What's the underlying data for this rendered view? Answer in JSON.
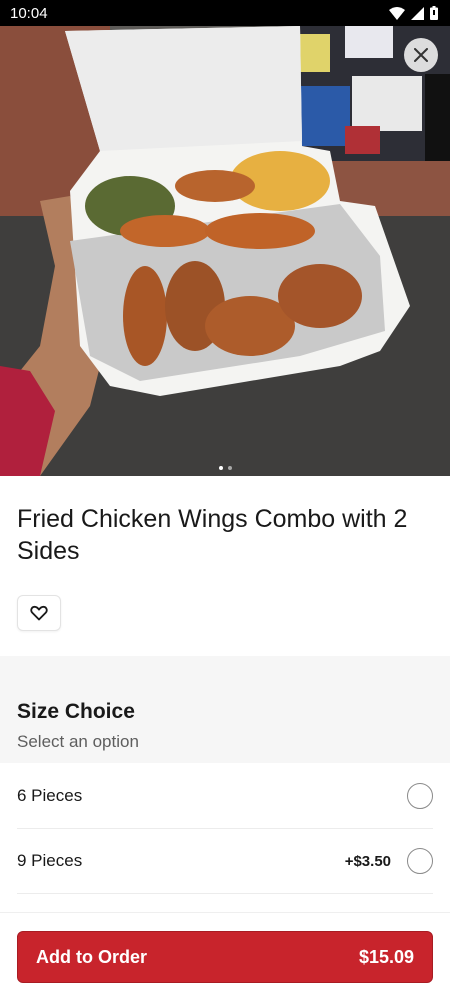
{
  "status_bar": {
    "time": "10:04",
    "icons": [
      "wifi-icon",
      "cell-signal-icon",
      "battery-icon"
    ]
  },
  "hero": {
    "image_description": "Hand holding a takeout container with fried chicken wings, green beans and mac and cheese",
    "slide_count": 2,
    "active_slide": 1
  },
  "item": {
    "title": "Fried Chicken Wings Combo with 2 Sides"
  },
  "size_choice": {
    "title": "Size Choice",
    "subtitle": "Select an option",
    "options": [
      {
        "label": "6 Pieces",
        "price": ""
      },
      {
        "label": "9 Pieces",
        "price": "+$3.50"
      }
    ]
  },
  "cta": {
    "label": "Add to Order",
    "price": "$15.09"
  },
  "colors": {
    "accent": "#c8242c",
    "section_bg": "#f6f6f6",
    "text": "#191919",
    "muted": "#5e5e5e"
  }
}
